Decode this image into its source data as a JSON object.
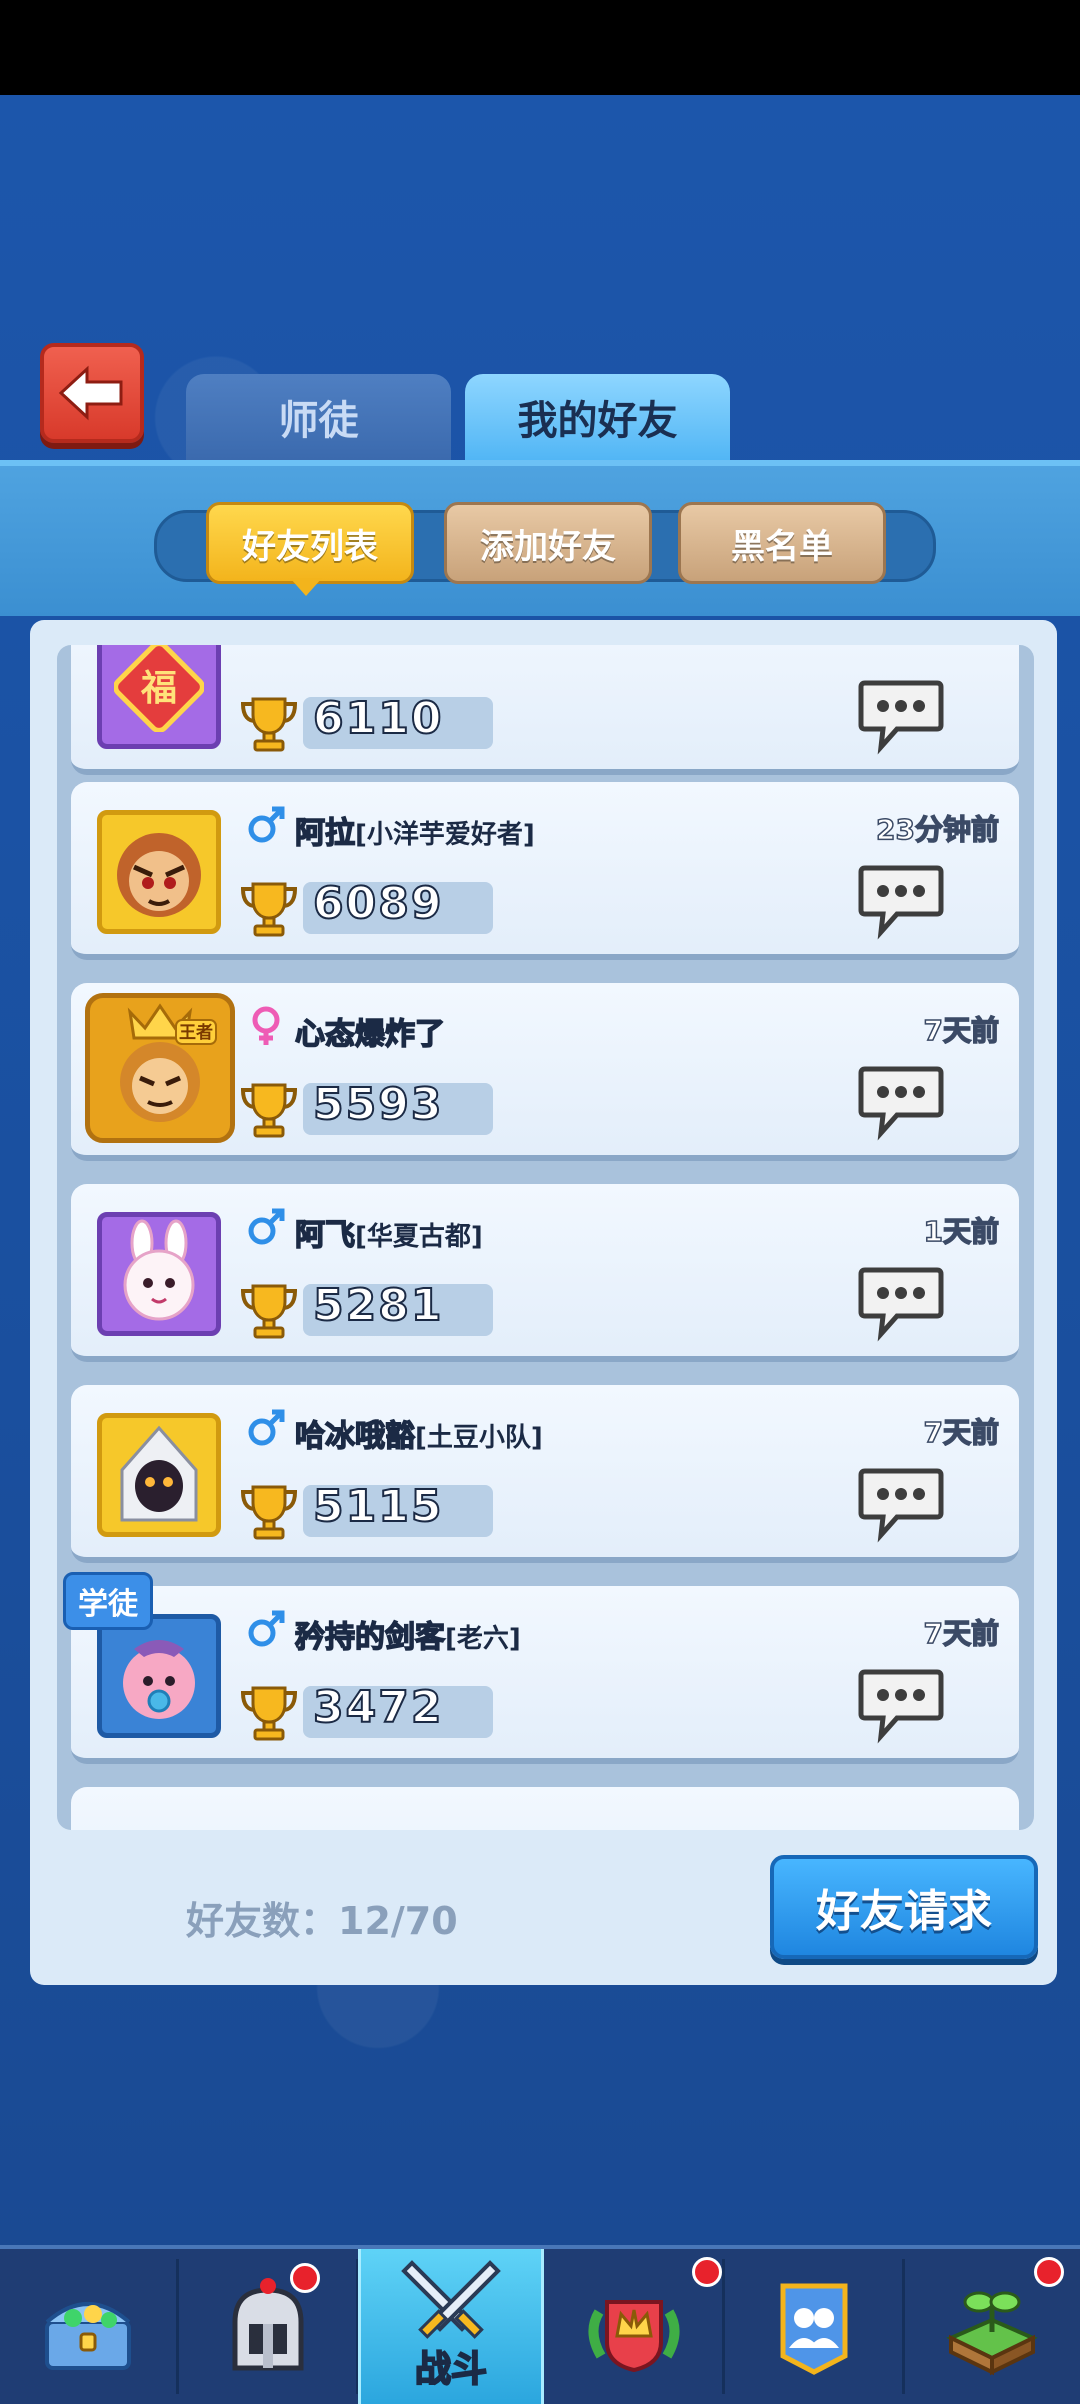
{
  "tabs": {
    "master": "师徒",
    "friends": "我的好友"
  },
  "segments": {
    "list": "好友列表",
    "add": "添加好友",
    "blacklist": "黑名单"
  },
  "friends": [
    {
      "gender": "male",
      "name": "",
      "guild": "",
      "time": "",
      "score": "6110",
      "badge": "福",
      "frame": "purple"
    },
    {
      "gender": "male",
      "name": "阿拉",
      "guild": "[小洋芋爱好者]",
      "time": "23分钟前",
      "score": "6089",
      "frame": "gold"
    },
    {
      "gender": "female",
      "name": "心态爆炸了",
      "guild": "",
      "time": "7天前",
      "score": "5593",
      "frame": "royal",
      "crown": "王者"
    },
    {
      "gender": "male",
      "name": "阿飞",
      "guild": "[华夏古都]",
      "time": "1天前",
      "score": "5281",
      "frame": "purple"
    },
    {
      "gender": "male",
      "name": "哈冰哦豁",
      "guild": "[土豆小队]",
      "time": "7天前",
      "score": "5115",
      "frame": "gold"
    },
    {
      "gender": "male",
      "name": "矜持的剑客",
      "guild": "[老六]",
      "time": "7天前",
      "score": "3472",
      "frame": "blue",
      "tag": "学徒"
    }
  ],
  "footer": {
    "count_label": "好友数：12/70",
    "request_button": "好友请求"
  },
  "nav": {
    "battle_label": "战斗"
  },
  "colors": {
    "male": "#2f8fe8",
    "female": "#ee5cb5",
    "accent": "#f3b41c"
  }
}
